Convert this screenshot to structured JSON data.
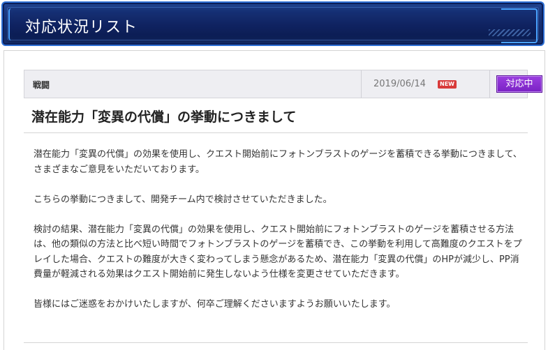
{
  "header": {
    "title": "対応状況リスト"
  },
  "entry": {
    "category": "戦闘",
    "date": "2019/06/14",
    "new_badge": "NEW",
    "status_label": "対応中",
    "title": "潜在能力「変異の代償」の挙動につきまして",
    "paragraphs": [
      "潜在能力「変異の代償」の効果を使用し、クエスト開始前にフォトンブラストのゲージを蓄積できる挙動につきまして、さまざまなご意見をいただいております。",
      "こちらの挙動につきまして、開発チーム内で検討させていただきました。",
      "検討の結果、潜在能力「変異の代償」の効果を使用し、クエスト開始前にフォトンブラストのゲージを蓄積させる方法は、他の類似の方法と比べ短い時間でフォトンブラストのゲージを蓄積でき、この挙動を利用して高難度のクエストをプレイした場合、クエストの難度が大きく変わってしまう懸念があるため、潜在能力「変異の代償」のHPが減少し、PP消費量が軽減される効果はクエスト開始前に発生しないよう仕様を変更させていただきます。",
      "皆様にはご迷惑をおかけいたしますが、何卒ご理解くださいますようお願いいたします。"
    ]
  },
  "colors": {
    "banner_bg": "#0f2260",
    "banner_border": "#2d6fd4",
    "status_bg": "#8a30d2",
    "new_badge_bg": "#d83a3a"
  }
}
